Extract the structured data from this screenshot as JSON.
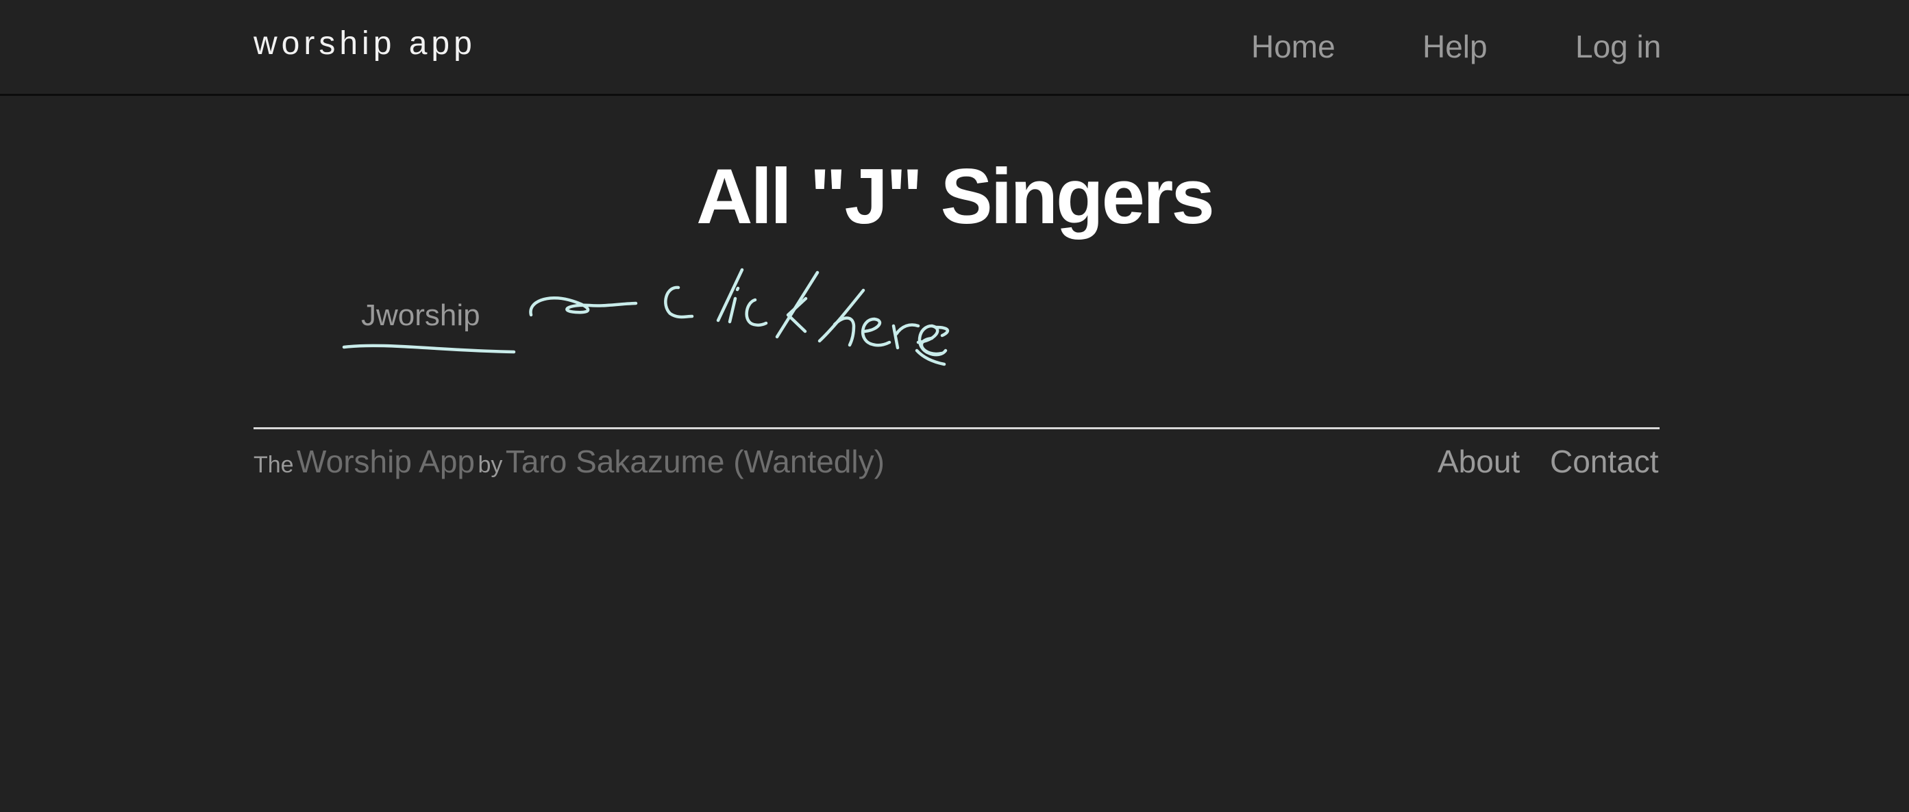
{
  "header": {
    "brand": "worship app",
    "nav": [
      {
        "label": "Home"
      },
      {
        "label": "Help"
      },
      {
        "label": "Log in"
      }
    ]
  },
  "main": {
    "title": "All \"J\" Singers",
    "singers": [
      {
        "label": "Jworship"
      }
    ],
    "annotation": {
      "text": "click here",
      "color": "#c9ecea"
    }
  },
  "footer": {
    "prefix": "The",
    "app_link": "Worship App",
    "by_text": "by",
    "author_link": "Taro Sakazume (Wantedly)",
    "links": [
      {
        "label": "About"
      },
      {
        "label": "Contact"
      }
    ]
  },
  "colors": {
    "background": "#222222",
    "title": "#ffffff",
    "link": "#9a9a9a",
    "muted_link": "#6e6e6e"
  }
}
